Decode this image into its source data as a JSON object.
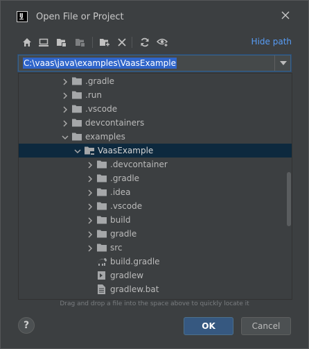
{
  "window": {
    "title": "Open File or Project",
    "app_logo_letters": "IJ"
  },
  "toolbar": {
    "buttons": [
      {
        "name": "home-directory",
        "icon": "home-icon"
      },
      {
        "name": "desktop",
        "icon": "desktop-icon"
      },
      {
        "name": "project-folder",
        "icon": "project-folder-icon"
      },
      {
        "name": "module-folder",
        "icon": "module-folder-icon"
      },
      {
        "name": "new-folder",
        "icon": "new-folder-icon"
      },
      {
        "name": "delete",
        "icon": "delete-x-icon"
      },
      {
        "name": "refresh",
        "icon": "refresh-icon"
      },
      {
        "name": "show-hidden",
        "icon": "show-hidden-icon"
      }
    ],
    "hide_path_label": "Hide path"
  },
  "path": {
    "value": "C:\\vaas\\java\\examples\\VaasExample"
  },
  "tree": {
    "items": [
      {
        "label": ".gradle",
        "expanded": false,
        "type": "folder",
        "depth": 0
      },
      {
        "label": ".run",
        "expanded": false,
        "type": "folder",
        "depth": 0
      },
      {
        "label": ".vscode",
        "expanded": false,
        "type": "folder",
        "depth": 0
      },
      {
        "label": "devcontainers",
        "expanded": false,
        "type": "folder",
        "depth": 0
      },
      {
        "label": "examples",
        "expanded": true,
        "type": "folder",
        "depth": 0
      },
      {
        "label": "VaasExample",
        "expanded": true,
        "type": "module-folder",
        "depth": 1,
        "selected": true
      },
      {
        "label": ".devcontainer",
        "expanded": false,
        "type": "folder",
        "depth": 2
      },
      {
        "label": ".gradle",
        "expanded": false,
        "type": "folder",
        "depth": 2
      },
      {
        "label": ".idea",
        "expanded": false,
        "type": "folder",
        "depth": 2
      },
      {
        "label": ".vscode",
        "expanded": false,
        "type": "folder",
        "depth": 2
      },
      {
        "label": "build",
        "expanded": false,
        "type": "folder",
        "depth": 2
      },
      {
        "label": "gradle",
        "expanded": false,
        "type": "folder",
        "depth": 2
      },
      {
        "label": "src",
        "expanded": false,
        "type": "folder",
        "depth": 2
      },
      {
        "label": "build.gradle",
        "type": "gradle-file",
        "depth": 2
      },
      {
        "label": "gradlew",
        "type": "script-file",
        "depth": 2
      },
      {
        "label": "gradlew.bat",
        "type": "text-file",
        "depth": 2
      }
    ],
    "drag_hint": "Drag and drop a file into the space above to quickly locate it"
  },
  "buttons": {
    "help": "?",
    "ok": "OK",
    "cancel": "Cancel"
  },
  "colors": {
    "background": "#3c3f41",
    "selection": "#0d293e",
    "link": "#589df6",
    "primary_button": "#365880",
    "text": "#bbbbbb"
  }
}
